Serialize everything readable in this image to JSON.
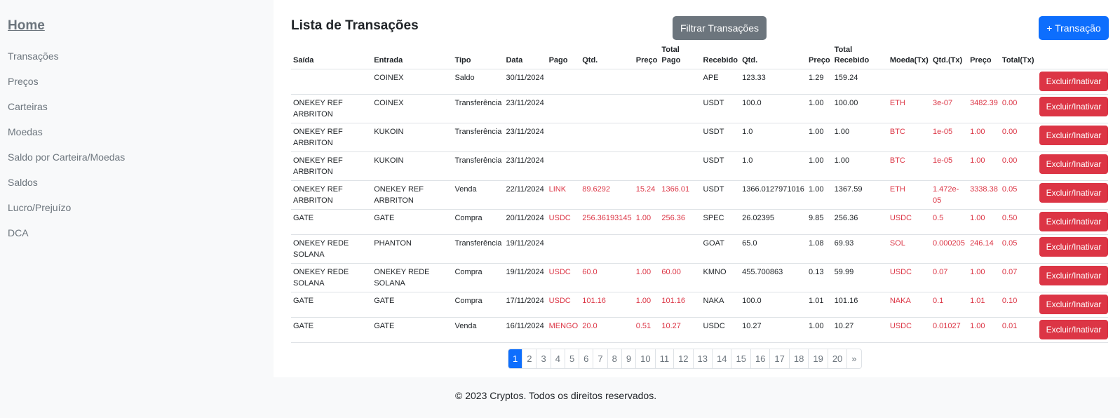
{
  "sidebar": {
    "home": "Home",
    "items": [
      "Transações",
      "Preços",
      "Carteiras",
      "Moedas",
      "Saldo por Carteira/Moedas",
      "Saldos",
      "Lucro/Prejuízo",
      "DCA"
    ]
  },
  "main": {
    "title": "Lista de Transações",
    "filter_label": "Filtrar Transações",
    "new_label": "+ Transação",
    "delete_label": "Excluir/Inativar"
  },
  "table": {
    "headers": [
      "Saída",
      "Entrada",
      "Tipo",
      "Data",
      "Pago",
      "Qtd.",
      "Preço",
      "Total Pago",
      "Recebido",
      "Qtd.",
      "Preço",
      "Total Recebido",
      "Moeda(Tx)",
      "Qtd.(Tx)",
      "Preço",
      "Total(Tx)"
    ],
    "rows": [
      {
        "saida": "",
        "entrada": "COINEX",
        "tipo": "Saldo",
        "data": "30/11/2024",
        "pago": "",
        "qtd_pago": "",
        "preco_pago": "",
        "total_pago": "",
        "recebido": "APE",
        "qtd_rec": "123.33",
        "preco_rec": "1.29",
        "total_rec": "159.24",
        "moeda_tx": "",
        "qtd_tx": "",
        "preco_tx": "",
        "total_tx": ""
      },
      {
        "saida": "ONEKEY REF ARBRITON",
        "entrada": "COINEX",
        "tipo": "Transferência",
        "data": "23/11/2024",
        "pago": "",
        "qtd_pago": "",
        "preco_pago": "",
        "total_pago": "",
        "recebido": "USDT",
        "qtd_rec": "100.0",
        "preco_rec": "1.00",
        "total_rec": "100.00",
        "moeda_tx": "ETH",
        "qtd_tx": "3e-07",
        "preco_tx": "3482.39",
        "total_tx": "0.00"
      },
      {
        "saida": "ONEKEY REF ARBRITON",
        "entrada": "KUKOIN",
        "tipo": "Transferência",
        "data": "23/11/2024",
        "pago": "",
        "qtd_pago": "",
        "preco_pago": "",
        "total_pago": "",
        "recebido": "USDT",
        "qtd_rec": "1.0",
        "preco_rec": "1.00",
        "total_rec": "1.00",
        "moeda_tx": "BTC",
        "qtd_tx": "1e-05",
        "preco_tx": "1.00",
        "total_tx": "0.00"
      },
      {
        "saida": "ONEKEY REF ARBRITON",
        "entrada": "KUKOIN",
        "tipo": "Transferência",
        "data": "23/11/2024",
        "pago": "",
        "qtd_pago": "",
        "preco_pago": "",
        "total_pago": "",
        "recebido": "USDT",
        "qtd_rec": "1.0",
        "preco_rec": "1.00",
        "total_rec": "1.00",
        "moeda_tx": "BTC",
        "qtd_tx": "1e-05",
        "preco_tx": "1.00",
        "total_tx": "0.00"
      },
      {
        "saida": "ONEKEY REF ARBRITON",
        "entrada": "ONEKEY REF ARBRITON",
        "tipo": "Venda",
        "data": "22/11/2024",
        "pago": "LINK",
        "qtd_pago": "89.6292",
        "preco_pago": "15.24",
        "total_pago": "1366.01",
        "recebido": "USDT",
        "qtd_rec": "1366.0127971016",
        "preco_rec": "1.00",
        "total_rec": "1367.59",
        "moeda_tx": "ETH",
        "qtd_tx": "1.472e-05",
        "preco_tx": "3338.38",
        "total_tx": "0.05"
      },
      {
        "saida": "GATE",
        "entrada": "GATE",
        "tipo": "Compra",
        "data": "20/11/2024",
        "pago": "USDC",
        "qtd_pago": "256.36193145",
        "preco_pago": "1.00",
        "total_pago": "256.36",
        "recebido": "SPEC",
        "qtd_rec": "26.02395",
        "preco_rec": "9.85",
        "total_rec": "256.36",
        "moeda_tx": "USDC",
        "qtd_tx": "0.5",
        "preco_tx": "1.00",
        "total_tx": "0.50"
      },
      {
        "saida": "ONEKEY REDE SOLANA",
        "entrada": "PHANTON",
        "tipo": "Transferência",
        "data": "19/11/2024",
        "pago": "",
        "qtd_pago": "",
        "preco_pago": "",
        "total_pago": "",
        "recebido": "GOAT",
        "qtd_rec": "65.0",
        "preco_rec": "1.08",
        "total_rec": "69.93",
        "moeda_tx": "SOL",
        "qtd_tx": "0.000205",
        "preco_tx": "246.14",
        "total_tx": "0.05"
      },
      {
        "saida": "ONEKEY REDE SOLANA",
        "entrada": "ONEKEY REDE SOLANA",
        "tipo": "Compra",
        "data": "19/11/2024",
        "pago": "USDC",
        "qtd_pago": "60.0",
        "preco_pago": "1.00",
        "total_pago": "60.00",
        "recebido": "KMNO",
        "qtd_rec": "455.700863",
        "preco_rec": "0.13",
        "total_rec": "59.99",
        "moeda_tx": "USDC",
        "qtd_tx": "0.07",
        "preco_tx": "1.00",
        "total_tx": "0.07"
      },
      {
        "saida": "GATE",
        "entrada": "GATE",
        "tipo": "Compra",
        "data": "17/11/2024",
        "pago": "USDC",
        "qtd_pago": "101.16",
        "preco_pago": "1.00",
        "total_pago": "101.16",
        "recebido": "NAKA",
        "qtd_rec": "100.0",
        "preco_rec": "1.01",
        "total_rec": "101.16",
        "moeda_tx": "NAKA",
        "qtd_tx": "0.1",
        "preco_tx": "1.01",
        "total_tx": "0.10"
      },
      {
        "saida": "GATE",
        "entrada": "GATE",
        "tipo": "Venda",
        "data": "16/11/2024",
        "pago": "MENGO",
        "qtd_pago": "20.0",
        "preco_pago": "0.51",
        "total_pago": "10.27",
        "recebido": "USDC",
        "qtd_rec": "10.27",
        "preco_rec": "1.00",
        "total_rec": "10.27",
        "moeda_tx": "USDC",
        "qtd_tx": "0.01027",
        "preco_tx": "1.00",
        "total_tx": "0.01"
      }
    ]
  },
  "pagination": {
    "pages": [
      "1",
      "2",
      "3",
      "4",
      "5",
      "6",
      "7",
      "8",
      "9",
      "10",
      "11",
      "12",
      "13",
      "14",
      "15",
      "16",
      "17",
      "18",
      "19",
      "20"
    ],
    "next": "»",
    "active": "1"
  },
  "footer": {
    "text": "© 2023 Cryptos. Todos os direitos reservados."
  },
  "colors": {
    "primary": "#0d6efd",
    "secondary": "#6c757d",
    "danger": "#dc3545"
  }
}
